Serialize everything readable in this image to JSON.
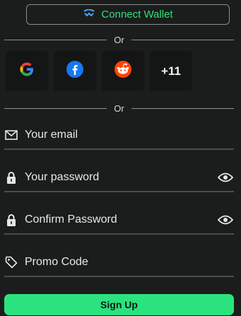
{
  "wallet": {
    "label": "Connect Wallet"
  },
  "divider_top": {
    "text": "Or"
  },
  "social": {
    "more_label": "+11"
  },
  "divider_bottom": {
    "text": "Or"
  },
  "form": {
    "email_placeholder": "Your email",
    "password_placeholder": "Your password",
    "confirm_placeholder": "Confirm Password",
    "promo_placeholder": "Promo Code"
  },
  "submit": {
    "label": "Sign Up"
  },
  "colors": {
    "accent": "#2be37e",
    "background": "#1b1d1c"
  }
}
